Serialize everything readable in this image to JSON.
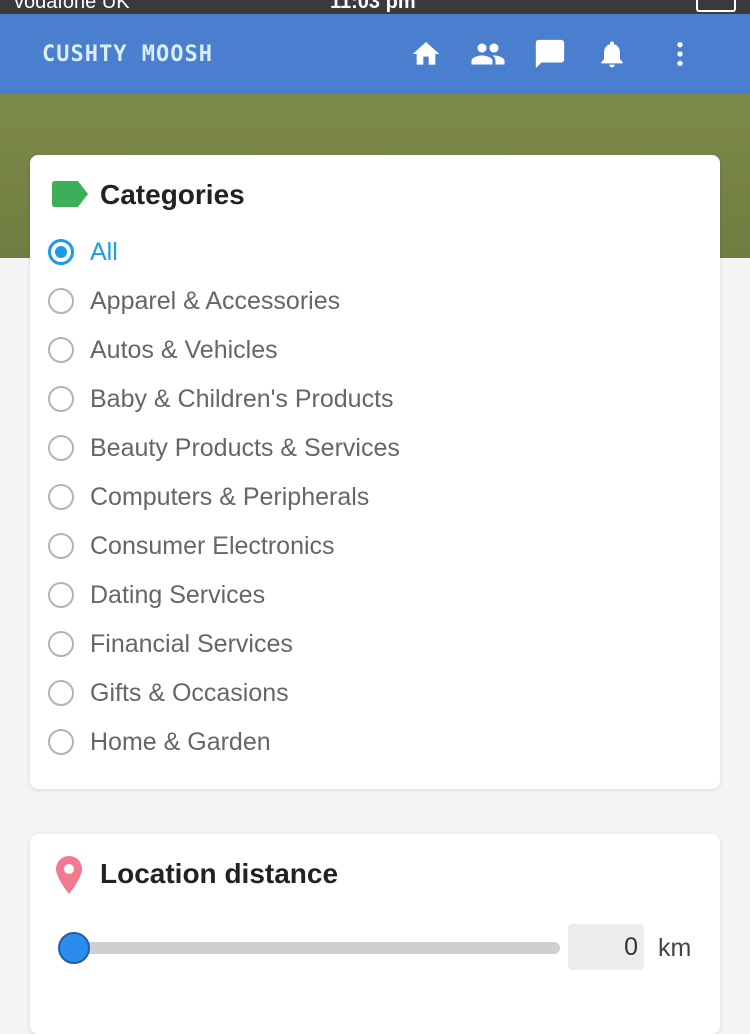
{
  "status_bar": {
    "carrier": "vodafone UK",
    "time": "11:03 pm"
  },
  "header": {
    "logo_text": "CUSHTY MOOSH",
    "icons": [
      "home-icon",
      "people-icon",
      "chat-icon",
      "bell-icon",
      "more-vertical-icon"
    ],
    "bar_color": "#4a7fd0"
  },
  "categories": {
    "title": "Categories",
    "title_icon": "tag-icon",
    "title_icon_color": "#3dae5a",
    "selected": "All",
    "options": [
      {
        "label": "All",
        "checked": true
      },
      {
        "label": "Apparel & Accessories",
        "checked": false
      },
      {
        "label": "Autos & Vehicles",
        "checked": false
      },
      {
        "label": "Baby & Children's Products",
        "checked": false
      },
      {
        "label": "Beauty Products & Services",
        "checked": false
      },
      {
        "label": "Computers & Peripherals",
        "checked": false
      },
      {
        "label": "Consumer Electronics",
        "checked": false
      },
      {
        "label": "Dating Services",
        "checked": false
      },
      {
        "label": "Financial Services",
        "checked": false
      },
      {
        "label": "Gifts & Occasions",
        "checked": false
      },
      {
        "label": "Home & Garden",
        "checked": false
      }
    ],
    "accent_color": "#1a9be6"
  },
  "location": {
    "title": "Location distance",
    "title_icon": "map-pin-icon",
    "title_icon_color": "#f07a8e",
    "distance_value": "0",
    "unit": "km",
    "slider_fraction": 0
  }
}
